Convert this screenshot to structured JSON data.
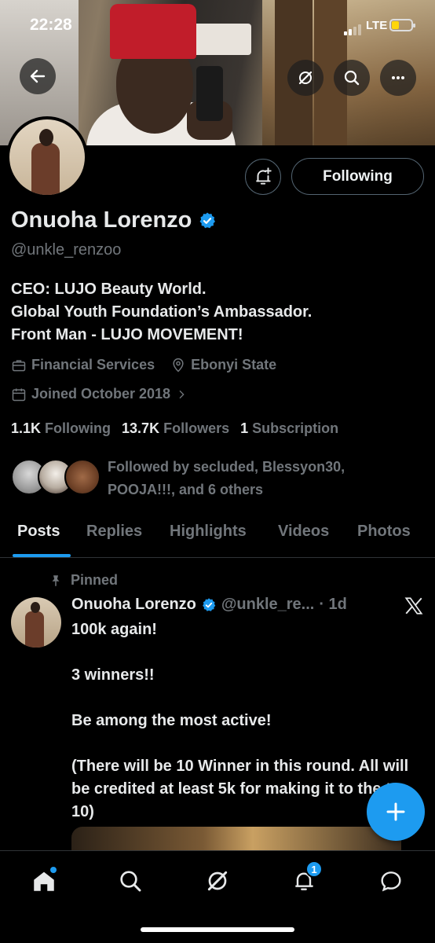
{
  "status": {
    "time": "22:28",
    "network": "LTE"
  },
  "profile": {
    "name": "Onuoha Lorenzo",
    "handle": "@unkle_renzoo",
    "bio": [
      "CEO: LUJO Beauty World.",
      "Global Youth Foundation’s Ambassador.",
      "Front Man - LUJO MOVEMENT!"
    ],
    "category": "Financial Services",
    "location": "Ebonyi State",
    "joined": "Joined October 2018",
    "following_count": "1.1K",
    "following_label": "Following",
    "followers_count": "13.7K",
    "followers_label": "Followers",
    "subscription_count": "1",
    "subscription_label": "Subscription",
    "followed_by": "Followed by secluded, Blessyon30, POOJA!!!, and 6 others",
    "follow_button": "Following"
  },
  "tabs": [
    "Posts",
    "Replies",
    "Highlights",
    "Videos",
    "Photos"
  ],
  "post": {
    "pinned_label": "Pinned",
    "author": "Onuoha Lorenzo",
    "handle": "@unkle_re...",
    "time": "· 1d",
    "text": "100k again!\n\n3 winners!!\n\nBe among the most active!\n\n(There will be 10 Winner in this round. All will be credited at least 5k for making it to the top 10)"
  },
  "nav": {
    "notifications_badge": "1"
  },
  "colors": {
    "accent": "#1d9bf0",
    "muted": "#71767b",
    "text": "#e7e9ea"
  }
}
